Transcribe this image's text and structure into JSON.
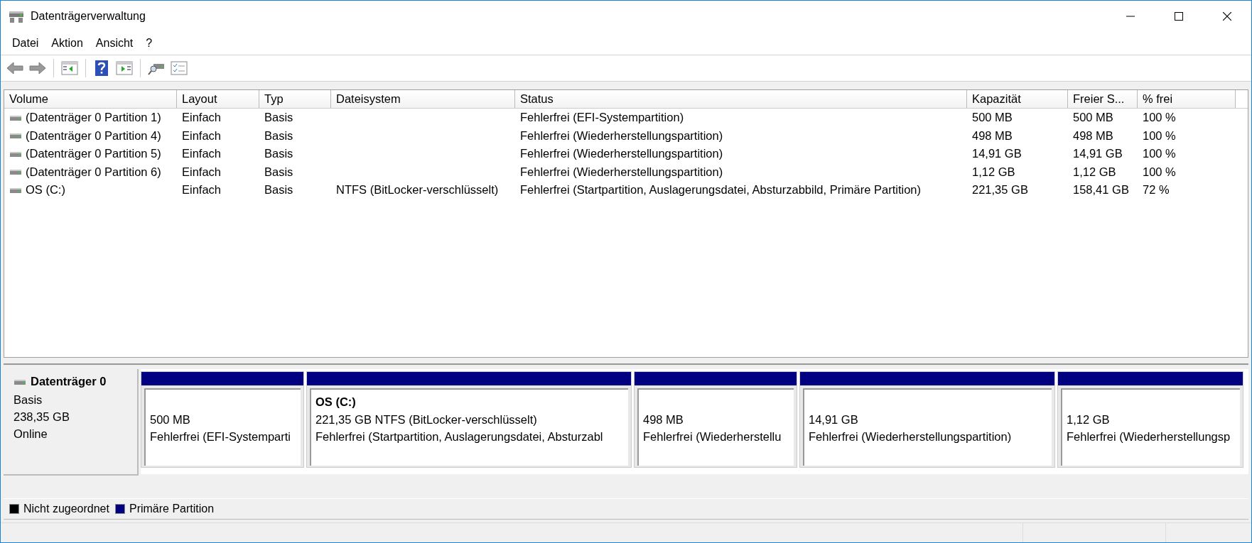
{
  "window": {
    "title": "Datenträgerverwaltung"
  },
  "menu": [
    {
      "label": "Datei"
    },
    {
      "label": "Aktion"
    },
    {
      "label": "Ansicht"
    },
    {
      "label": "?"
    }
  ],
  "table": {
    "columns": [
      "Volume",
      "Layout",
      "Typ",
      "Dateisystem",
      "Status",
      "Kapazität",
      "Freier S...",
      "% frei"
    ],
    "rows": [
      {
        "cells": [
          "(Datenträger 0 Partition 1)",
          "Einfach",
          "Basis",
          "",
          "Fehlerfrei (EFI-Systempartition)",
          "500 MB",
          "500 MB",
          "100 %"
        ]
      },
      {
        "cells": [
          "(Datenträger 0 Partition 4)",
          "Einfach",
          "Basis",
          "",
          "Fehlerfrei (Wiederherstellungspartition)",
          "498 MB",
          "498 MB",
          "100 %"
        ]
      },
      {
        "cells": [
          "(Datenträger 0 Partition 5)",
          "Einfach",
          "Basis",
          "",
          "Fehlerfrei (Wiederherstellungspartition)",
          "14,91 GB",
          "14,91 GB",
          "100 %"
        ]
      },
      {
        "cells": [
          "(Datenträger 0 Partition 6)",
          "Einfach",
          "Basis",
          "",
          "Fehlerfrei (Wiederherstellungspartition)",
          "1,12 GB",
          "1,12 GB",
          "100 %"
        ]
      },
      {
        "cells": [
          "OS (C:)",
          "Einfach",
          "Basis",
          "NTFS (BitLocker-verschlüsselt)",
          "Fehlerfrei (Startpartition, Auslagerungsdatei, Absturzabbild, Primäre Partition)",
          "221,35 GB",
          "158,41 GB",
          "72 %"
        ]
      }
    ]
  },
  "disk": {
    "name": "Datenträger 0",
    "type": "Basis",
    "size": "238,35 GB",
    "status": "Online",
    "partitions": [
      {
        "color": "#000080",
        "size": "500 MB",
        "status": "Fehlerfrei (EFI-Systemparti"
      },
      {
        "color": "#000080",
        "label": "OS  (C:)",
        "size": "221,35 GB NTFS (BitLocker-verschlüsselt)",
        "status": "Fehlerfrei (Startpartition, Auslagerungsdatei, Absturzabl"
      },
      {
        "color": "#000080",
        "size": "498 MB",
        "status": "Fehlerfrei (Wiederherstellu"
      },
      {
        "color": "#000080",
        "size": "14,91 GB",
        "status": "Fehlerfrei (Wiederherstellungspartition)"
      },
      {
        "color": "#000080",
        "size": "1,12 GB",
        "status": "Fehlerfrei (Wiederherstellungsp"
      }
    ]
  },
  "legend": [
    {
      "label": "Nicht zugeordnet",
      "color": "#000000"
    },
    {
      "label": "Primäre Partition",
      "color": "#000080"
    }
  ]
}
